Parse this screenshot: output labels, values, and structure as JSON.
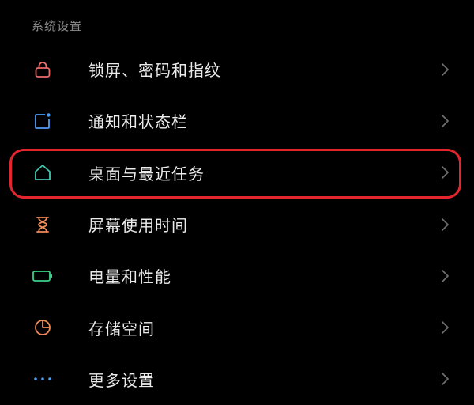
{
  "section": {
    "title": "系统设置"
  },
  "colors": {
    "background": "#000000",
    "highlight": "#e3262e",
    "chevron": "#6e6e6e"
  },
  "items": [
    {
      "label": "锁屏、密码和指纹",
      "icon": "lock-icon",
      "icon_color": "#ec6c6c"
    },
    {
      "label": "通知和状态栏",
      "icon": "notification-icon",
      "icon_color": "#4d9df0"
    },
    {
      "label": "桌面与最近任务",
      "icon": "home-icon",
      "icon_color": "#3fc7ad"
    },
    {
      "label": "屏幕使用时间",
      "icon": "hourglass-icon",
      "icon_color": "#f08b5a"
    },
    {
      "label": "电量和性能",
      "icon": "battery-icon",
      "icon_color": "#3ccf89"
    },
    {
      "label": "存储空间",
      "icon": "storage-pie-icon",
      "icon_color": "#f08b5a"
    },
    {
      "label": "更多设置",
      "icon": "more-dots-icon",
      "icon_color": "#4d9df0"
    }
  ]
}
